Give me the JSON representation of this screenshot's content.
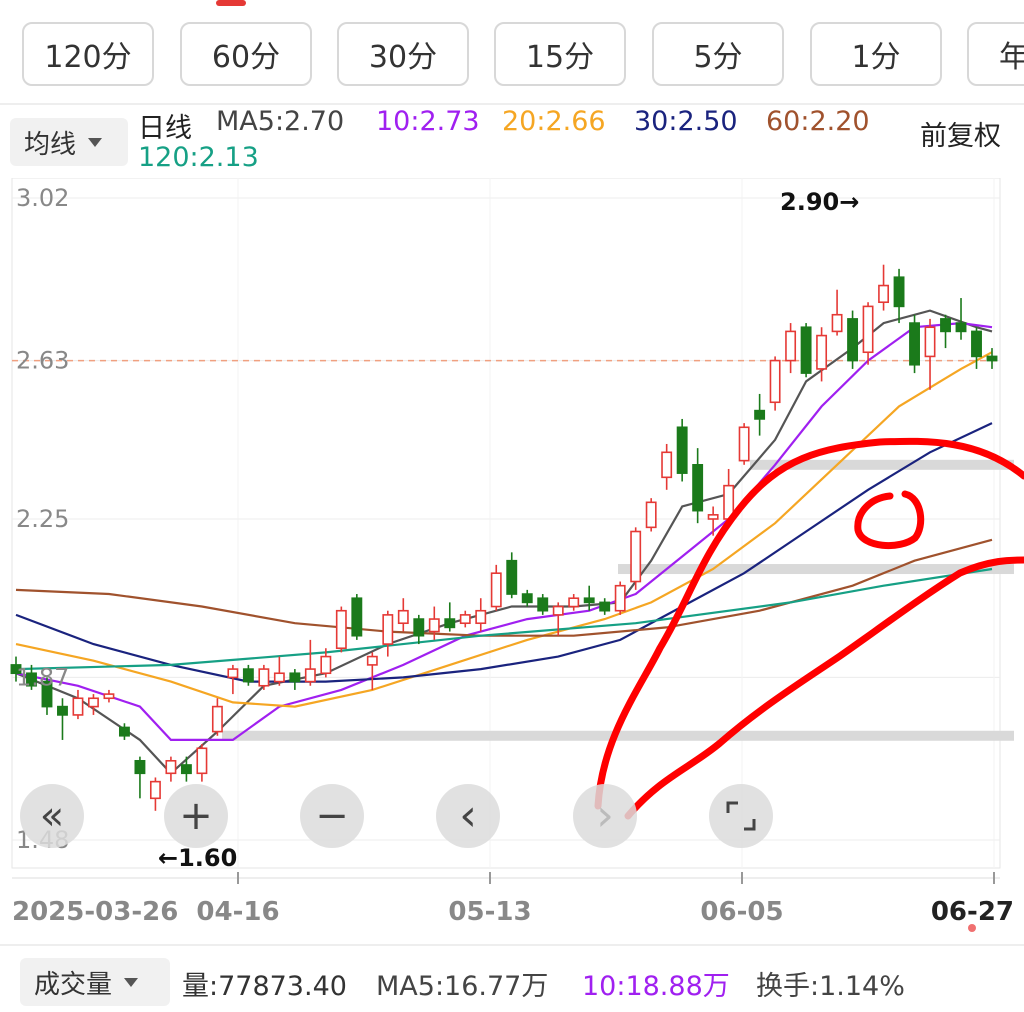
{
  "period_tabs": [
    "120分",
    "60分",
    "30分",
    "15分",
    "5分",
    "1分",
    "年"
  ],
  "ma_header": {
    "selector_label": "均线",
    "period_label": "日线",
    "ma5": "MA5:2.70",
    "ma10": "10:2.73",
    "ma20": "20:2.66",
    "ma30": "30:2.50",
    "ma60": "60:2.20",
    "ma120": "120:2.13",
    "adjust_label": "前复权"
  },
  "colors": {
    "up": "#e53935",
    "down": "#1b7a1b",
    "ma5": "#555555",
    "ma10": "#a020f0",
    "ma20": "#f5a623",
    "ma30": "#1a237e",
    "ma60": "#a0522d",
    "ma120": "#16a085",
    "annotation": "#ff0000"
  },
  "chart_data": {
    "type": "candlestick",
    "y_ticks": [
      "3.02",
      "2.63",
      "2.25",
      "1.87",
      "1.48"
    ],
    "ylim": [
      1.48,
      3.02
    ],
    "x_ticks": [
      "2025-03-26",
      "04-16",
      "05-13",
      "06-05",
      "06-27"
    ],
    "high_marker": "2.90→",
    "low_marker": "←1.60",
    "last_price_line": 2.63,
    "candles": [
      [
        1.9,
        1.88,
        1.92,
        1.86
      ],
      [
        1.88,
        1.85,
        1.9,
        1.84
      ],
      [
        1.86,
        1.8,
        1.87,
        1.78
      ],
      [
        1.8,
        1.78,
        1.82,
        1.72
      ],
      [
        1.78,
        1.82,
        1.84,
        1.77
      ],
      [
        1.8,
        1.82,
        1.83,
        1.78
      ],
      [
        1.82,
        1.83,
        1.84,
        1.81
      ],
      [
        1.75,
        1.73,
        1.76,
        1.72
      ],
      [
        1.67,
        1.64,
        1.68,
        1.58
      ],
      [
        1.58,
        1.62,
        1.63,
        1.55
      ],
      [
        1.64,
        1.67,
        1.68,
        1.62
      ],
      [
        1.66,
        1.64,
        1.68,
        1.62
      ],
      [
        1.64,
        1.7,
        1.71,
        1.62
      ],
      [
        1.74,
        1.8,
        1.82,
        1.73
      ],
      [
        1.87,
        1.89,
        1.9,
        1.83
      ],
      [
        1.89,
        1.86,
        1.9,
        1.85
      ],
      [
        1.85,
        1.89,
        1.9,
        1.84
      ],
      [
        1.86,
        1.88,
        1.92,
        1.85
      ],
      [
        1.88,
        1.86,
        1.89,
        1.84
      ],
      [
        1.86,
        1.89,
        1.96,
        1.85
      ],
      [
        1.88,
        1.92,
        1.94,
        1.87
      ],
      [
        1.94,
        2.03,
        2.04,
        1.93
      ],
      [
        2.06,
        1.97,
        2.07,
        1.96
      ],
      [
        1.9,
        1.92,
        1.93,
        1.84
      ],
      [
        1.95,
        2.02,
        2.03,
        1.92
      ],
      [
        2.0,
        2.03,
        2.06,
        1.98
      ],
      [
        2.01,
        1.97,
        2.02,
        1.95
      ],
      [
        1.98,
        2.01,
        2.04,
        1.96
      ],
      [
        2.01,
        1.99,
        2.05,
        1.98
      ],
      [
        2.0,
        2.02,
        2.03,
        1.99
      ],
      [
        2.0,
        2.03,
        2.06,
        1.98
      ],
      [
        2.04,
        2.12,
        2.14,
        2.03
      ],
      [
        2.15,
        2.07,
        2.17,
        2.06
      ],
      [
        2.07,
        2.05,
        2.08,
        2.04
      ],
      [
        2.06,
        2.03,
        2.07,
        2.02
      ],
      [
        2.02,
        2.04,
        2.05,
        1.97
      ],
      [
        2.04,
        2.06,
        2.07,
        2.03
      ],
      [
        2.06,
        2.05,
        2.09,
        2.03
      ],
      [
        2.05,
        2.03,
        2.06,
        2.02
      ],
      [
        2.03,
        2.09,
        2.1,
        2.02
      ],
      [
        2.1,
        2.22,
        2.23,
        2.08
      ],
      [
        2.23,
        2.29,
        2.3,
        2.22
      ],
      [
        2.35,
        2.41,
        2.43,
        2.32
      ],
      [
        2.47,
        2.36,
        2.49,
        2.34
      ],
      [
        2.38,
        2.27,
        2.42,
        2.24
      ],
      [
        2.25,
        2.26,
        2.28,
        2.21
      ],
      [
        2.25,
        2.33,
        2.37,
        2.24
      ],
      [
        2.39,
        2.47,
        2.48,
        2.38
      ],
      [
        2.51,
        2.49,
        2.55,
        2.45
      ],
      [
        2.53,
        2.63,
        2.64,
        2.51
      ],
      [
        2.63,
        2.7,
        2.72,
        2.6
      ],
      [
        2.71,
        2.6,
        2.72,
        2.59
      ],
      [
        2.61,
        2.69,
        2.71,
        2.58
      ],
      [
        2.7,
        2.74,
        2.8,
        2.69
      ],
      [
        2.73,
        2.63,
        2.75,
        2.61
      ],
      [
        2.65,
        2.76,
        2.77,
        2.62
      ],
      [
        2.77,
        2.81,
        2.86,
        2.75
      ],
      [
        2.83,
        2.76,
        2.85,
        2.72
      ],
      [
        2.72,
        2.62,
        2.74,
        2.6
      ],
      [
        2.64,
        2.71,
        2.73,
        2.56
      ],
      [
        2.73,
        2.7,
        2.74,
        2.66
      ],
      [
        2.72,
        2.7,
        2.78,
        2.68
      ],
      [
        2.7,
        2.64,
        2.71,
        2.61
      ],
      [
        2.64,
        2.63,
        2.66,
        2.61
      ]
    ],
    "ma_series": [
      {
        "name": "MA5",
        "points": [
          [
            0,
            1.88
          ],
          [
            4,
            1.82
          ],
          [
            8,
            1.72
          ],
          [
            10,
            1.64
          ],
          [
            13,
            1.74
          ],
          [
            16,
            1.85
          ],
          [
            20,
            1.88
          ],
          [
            24,
            1.95
          ],
          [
            28,
            2.0
          ],
          [
            32,
            2.04
          ],
          [
            36,
            2.04
          ],
          [
            39,
            2.05
          ],
          [
            41,
            2.15
          ],
          [
            43,
            2.28
          ],
          [
            46,
            2.31
          ],
          [
            49,
            2.44
          ],
          [
            51,
            2.58
          ],
          [
            54,
            2.66
          ],
          [
            56,
            2.72
          ],
          [
            59,
            2.75
          ],
          [
            62,
            2.71
          ],
          [
            63,
            2.7
          ]
        ]
      },
      {
        "name": "MA10",
        "points": [
          [
            0,
            1.88
          ],
          [
            4,
            1.85
          ],
          [
            8,
            1.8
          ],
          [
            10,
            1.72
          ],
          [
            14,
            1.72
          ],
          [
            17,
            1.8
          ],
          [
            21,
            1.84
          ],
          [
            25,
            1.9
          ],
          [
            29,
            1.97
          ],
          [
            33,
            2.01
          ],
          [
            37,
            2.03
          ],
          [
            40,
            2.07
          ],
          [
            43,
            2.16
          ],
          [
            46,
            2.25
          ],
          [
            49,
            2.38
          ],
          [
            52,
            2.52
          ],
          [
            55,
            2.63
          ],
          [
            58,
            2.71
          ],
          [
            61,
            2.72
          ],
          [
            63,
            2.71
          ]
        ]
      },
      {
        "name": "MA20",
        "points": [
          [
            0,
            1.95
          ],
          [
            5,
            1.91
          ],
          [
            10,
            1.86
          ],
          [
            14,
            1.81
          ],
          [
            18,
            1.8
          ],
          [
            23,
            1.84
          ],
          [
            28,
            1.9
          ],
          [
            33,
            1.96
          ],
          [
            38,
            2.01
          ],
          [
            41,
            2.05
          ],
          [
            45,
            2.13
          ],
          [
            49,
            2.24
          ],
          [
            53,
            2.38
          ],
          [
            57,
            2.52
          ],
          [
            61,
            2.61
          ],
          [
            63,
            2.65
          ]
        ]
      },
      {
        "name": "MA30",
        "points": [
          [
            0,
            2.02
          ],
          [
            5,
            1.95
          ],
          [
            10,
            1.9
          ],
          [
            15,
            1.86
          ],
          [
            20,
            1.86
          ],
          [
            25,
            1.87
          ],
          [
            30,
            1.89
          ],
          [
            35,
            1.92
          ],
          [
            39,
            1.96
          ],
          [
            43,
            2.04
          ],
          [
            47,
            2.12
          ],
          [
            51,
            2.22
          ],
          [
            55,
            2.32
          ],
          [
            59,
            2.41
          ],
          [
            63,
            2.48
          ]
        ]
      },
      {
        "name": "MA60",
        "points": [
          [
            0,
            2.08
          ],
          [
            6,
            2.07
          ],
          [
            12,
            2.04
          ],
          [
            18,
            2.0
          ],
          [
            24,
            1.98
          ],
          [
            30,
            1.97
          ],
          [
            36,
            1.97
          ],
          [
            42,
            1.99
          ],
          [
            48,
            2.03
          ],
          [
            54,
            2.09
          ],
          [
            58,
            2.15
          ],
          [
            63,
            2.2
          ]
        ]
      },
      {
        "name": "MA120",
        "points": [
          [
            0,
            1.89
          ],
          [
            10,
            1.9
          ],
          [
            20,
            1.93
          ],
          [
            30,
            1.97
          ],
          [
            40,
            2.0
          ],
          [
            50,
            2.05
          ],
          [
            56,
            2.09
          ],
          [
            63,
            2.13
          ]
        ]
      }
    ]
  },
  "nav_controls": [
    "«",
    "+",
    "−",
    "‹",
    "›",
    "⌐"
  ],
  "volume_header": {
    "selector_label": "成交量",
    "volume": "量:77873.40",
    "ma5": "MA5:16.77万",
    "ma10": "10:18.88万",
    "turnover": "换手:1.14%"
  }
}
